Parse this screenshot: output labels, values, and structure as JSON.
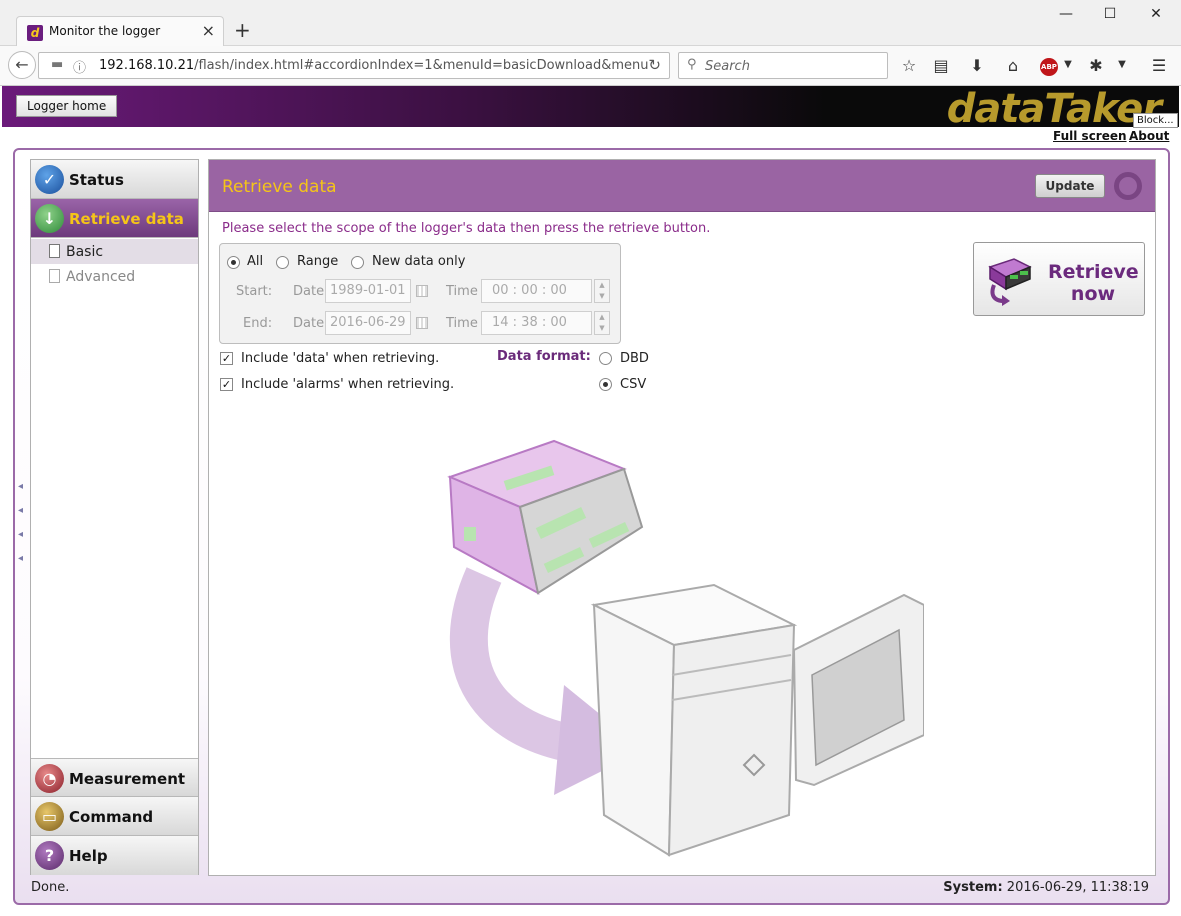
{
  "browser": {
    "tab_title": "Monitor the logger",
    "url_host": "192.168.10.21",
    "url_path": "/flash/index.html#accordionIndex=1&menuId=basicDownload&menu",
    "search_placeholder": "Search",
    "abp_label": "ABP"
  },
  "header": {
    "logger_home": "Logger home",
    "brand": "dataTaker",
    "blocked_popup": "Block...",
    "full_screen": "Full screen",
    "about": "About"
  },
  "sidebar": {
    "status": "Status",
    "retrieve_data": "Retrieve data",
    "sub_basic": "Basic",
    "sub_advanced": "Advanced",
    "measurement": "Measurement",
    "command": "Command",
    "help": "Help"
  },
  "content": {
    "title": "Retrieve data",
    "update": "Update",
    "instruction": "Please select the scope of the logger's data then press the retrieve button.",
    "scope": {
      "all": "All",
      "range": "Range",
      "new_only": "New data only",
      "selected": "All",
      "start_label": "Start:",
      "end_label": "End:",
      "date_label": "Date",
      "time_label": "Time",
      "start_date": "1989-01-01",
      "end_date": "2016-06-29",
      "start_time": "00 :  00 :  00",
      "end_time": "14 :  38 :  00"
    },
    "include_data": "Include 'data' when retrieving.",
    "include_alarms": "Include 'alarms' when retrieving.",
    "include_data_checked": true,
    "include_alarms_checked": true,
    "data_format_label": "Data format:",
    "format_dbd": "DBD",
    "format_csv": "CSV",
    "format_selected": "CSV",
    "retrieve_line1": "Retrieve",
    "retrieve_line2": "now"
  },
  "status_bar": {
    "left": "Done.",
    "system_label": "System:",
    "system_time": "2016-06-29, 11:38:19"
  },
  "colors": {
    "accent_purple": "#9a64a3",
    "accent_gold": "#f5c518",
    "text_purple": "#8a2b8a"
  }
}
